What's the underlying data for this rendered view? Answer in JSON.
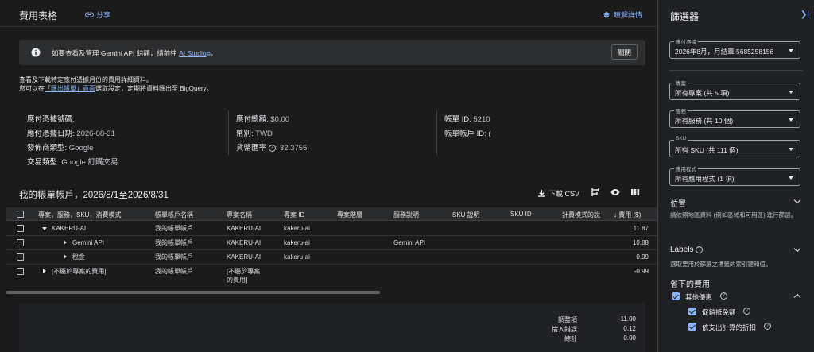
{
  "header": {
    "title": "費用表格",
    "share": "分享",
    "learn_more": "瞭解詳情"
  },
  "banner": {
    "text_before": "如要查看及管理 Gemini API 餘額，請前往",
    "link": "AI Studio",
    "text_after": "。",
    "close": "關閉"
  },
  "description": {
    "line1": "查看及下載特定應付憑據月份的費用詳細資料。",
    "line2_before": "您可以在",
    "line2_link": "「匯出帳單」頁面",
    "line2_after": "選取設定，定期將資料匯出至 BigQuery。"
  },
  "invoice": {
    "col1": [
      {
        "label": "應付憑據號碼:",
        "value": ""
      },
      {
        "label": "應付憑據日期:",
        "value": "2026-08-31"
      },
      {
        "label": "發佈商類型:",
        "value": "Google"
      },
      {
        "label": "交易類型:",
        "value": "Google 訂購交易"
      }
    ],
    "col2": [
      {
        "label": "應付總額:",
        "value": "$0.00"
      },
      {
        "label": "幣別:",
        "value": "TWD"
      },
      {
        "label": "貨幣匯率",
        "value": ": 32.3755"
      }
    ],
    "col3": [
      {
        "label": "帳單 ID:",
        "value": "5210"
      },
      {
        "label": "帳單帳戶 ID:",
        "value": "("
      }
    ]
  },
  "table": {
    "title": "我的帳單帳戶，2026/8/1至2026/8/31",
    "download": "下載 CSV",
    "headers": [
      "專案，服務，SKU，消費模式",
      "帳單帳戶名稱",
      "專案名稱",
      "專案 ID",
      "專案階層",
      "服務說明",
      "SKU 說明",
      "SKU ID",
      "計費模式的說",
      "費用 ($)"
    ],
    "rows": [
      {
        "name": "KAKERU-AI",
        "account": "我的帳單帳戶",
        "project": "KAKERU-AI",
        "project_id": "kakeru-ai",
        "service": "",
        "cost": "11.87"
      },
      {
        "name": "Gemini API",
        "account": "我的帳單帳戶",
        "project": "KAKERU-AI",
        "project_id": "kakeru-ai",
        "service": "Gemini API",
        "cost": "10.88"
      },
      {
        "name": "稅金",
        "account": "我的帳單帳戶",
        "project": "KAKERU-AI",
        "project_id": "kakeru-ai",
        "service": "",
        "cost": "0.99"
      },
      {
        "name": "[不屬於專案的費用]",
        "account": "我的帳單帳戶",
        "project": "[不屬於專案",
        "project2": "的費用]",
        "project_id": "",
        "service": "",
        "cost": "-0.99"
      }
    ]
  },
  "totals": [
    {
      "label": "調整項",
      "value": "-11.00"
    },
    {
      "label": "捨入錯誤",
      "value": "0.12"
    },
    {
      "label": "總計",
      "value": "0.00"
    }
  ],
  "sidebar": {
    "title": "篩選器",
    "invoice_month": {
      "label": "應付憑據",
      "value": "2026年8月，月結單 5685258156"
    },
    "projects": {
      "label": "專案",
      "value": "所有專案 (共 5 項)"
    },
    "services": {
      "label": "服務",
      "value": "所有服務 (共 10 個)"
    },
    "sku": {
      "label": "SKU",
      "value": "所有 SKU (共 111 個)"
    },
    "apps": {
      "label": "應用程式",
      "value": "所有應用程式 (1 項)"
    },
    "location": {
      "title": "位置",
      "desc": "請依照地區資料 (例如區域和可用區) 進行篩選。"
    },
    "labels": {
      "title": "Labels",
      "desc": "選取要用於篩選之標籤的索引鍵和值。"
    },
    "savings": {
      "title": "省下的費用",
      "other": "其他優惠",
      "promo": "促銷抵免額",
      "spend": "依支出計算的折扣"
    }
  },
  "colors": {
    "accent": "#8ab4f8",
    "bg": "#1b1b1c",
    "panel": "#202124"
  }
}
